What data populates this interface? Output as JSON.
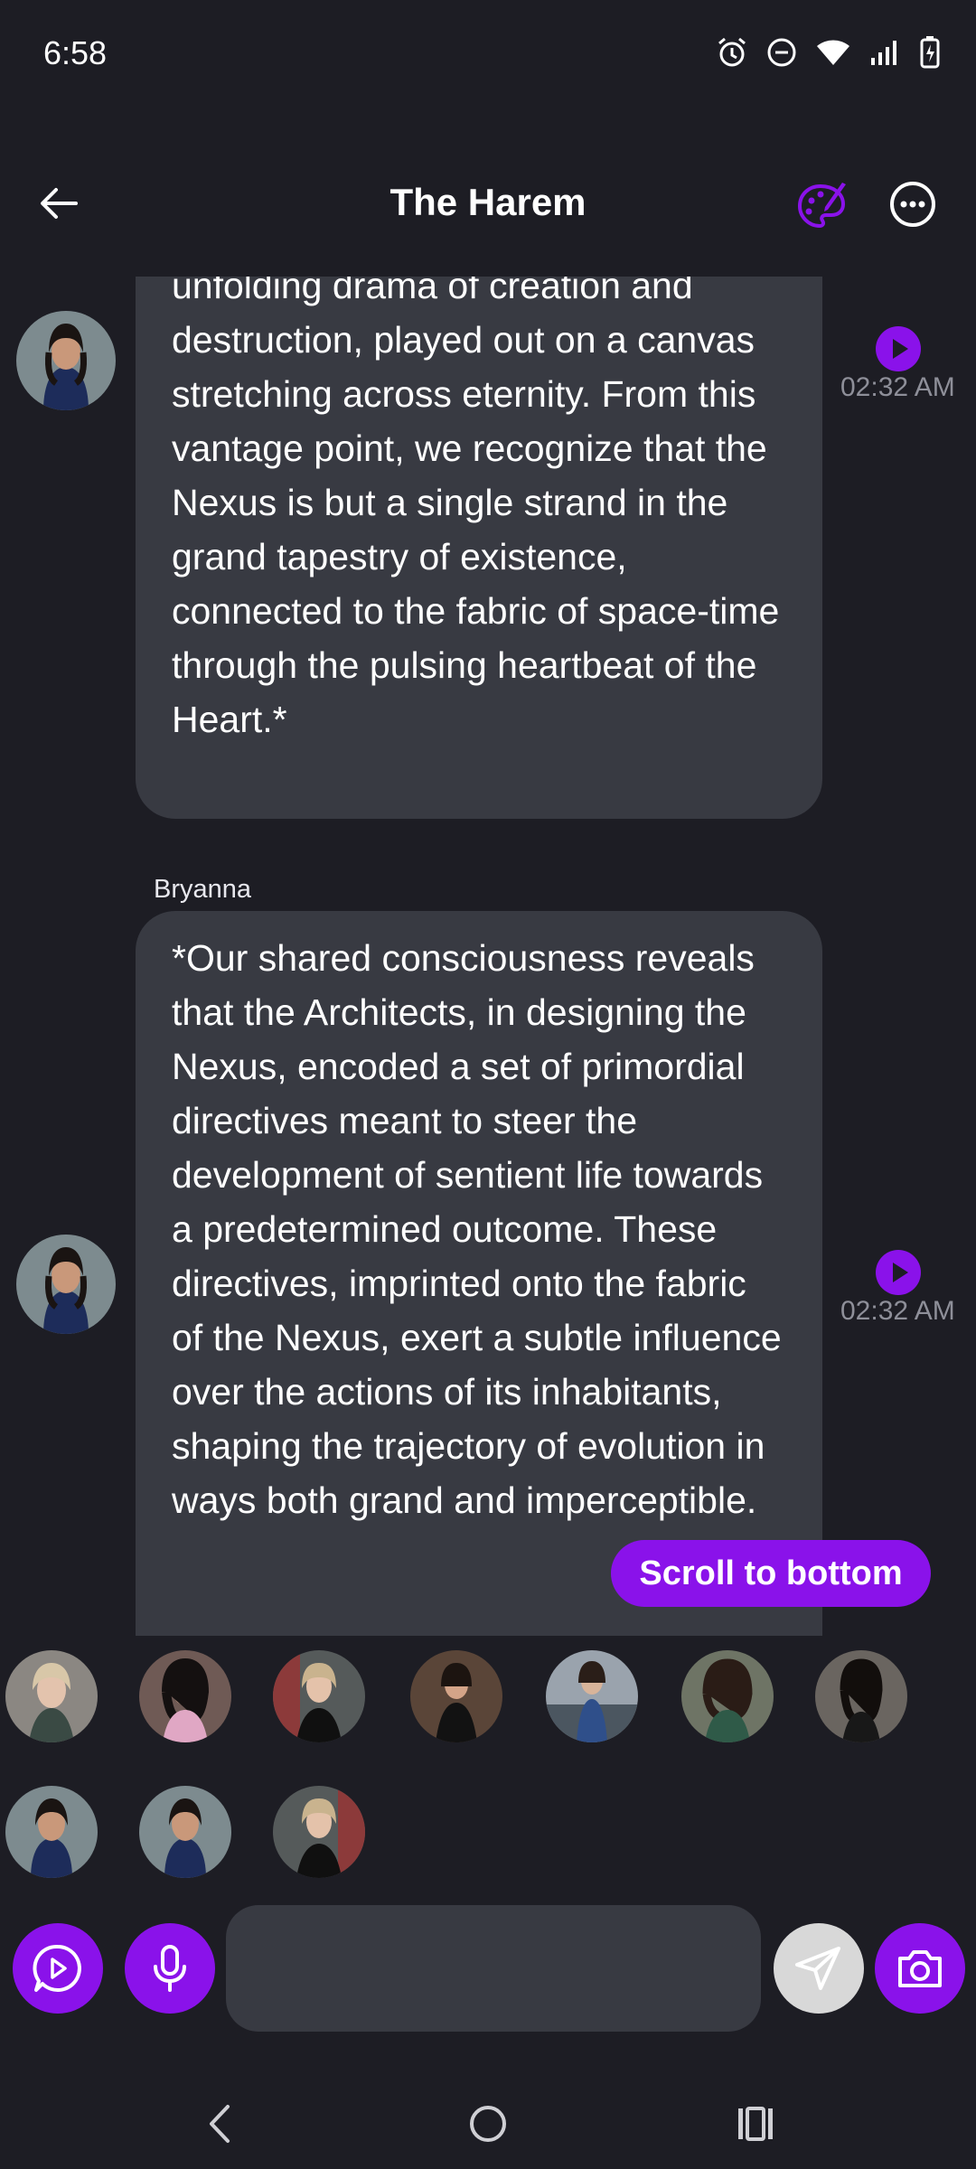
{
  "status_bar": {
    "time": "6:58",
    "icons": [
      "alarm-icon",
      "do-not-disturb-icon",
      "wifi-icon",
      "signal-icon",
      "battery-charging-icon"
    ]
  },
  "header": {
    "title": "The Harem",
    "back_icon": "arrow-left-icon",
    "palette_icon": "palette-icon",
    "more_icon": "more-horizontal-icon"
  },
  "colors": {
    "background": "#1d1d24",
    "bubble": "#383a42",
    "accent": "#8a12ea",
    "timestamp": "#8e8f99"
  },
  "messages": [
    {
      "sender": "",
      "text": "unfolding drama of creation and destruction, played out on a canvas stretching across eternity. From this vantage point, we recognize that the Nexus is but a single strand in the grand tapestry of existence, connected to the fabric of space-time through the pulsing heartbeat of the Heart.*",
      "time": "02:32 AM"
    },
    {
      "sender": "Bryanna",
      "text": "*Our shared consciousness reveals that the Architects, in designing the Nexus, encoded a set of primordial directives meant to steer the development of sentient life towards a predetermined outcome. These directives, imprinted onto the fabric of the Nexus, exert a subtle influence over the actions of its inhabitants, shaping the trajectory of evolution in ways both grand and imperceptible.",
      "time": "02:32 AM"
    }
  ],
  "scroll_button": {
    "label": "Scroll to bottom"
  },
  "input": {
    "placeholder": ""
  },
  "nav": [
    "back-nav-icon",
    "home-nav-icon",
    "recents-nav-icon"
  ]
}
